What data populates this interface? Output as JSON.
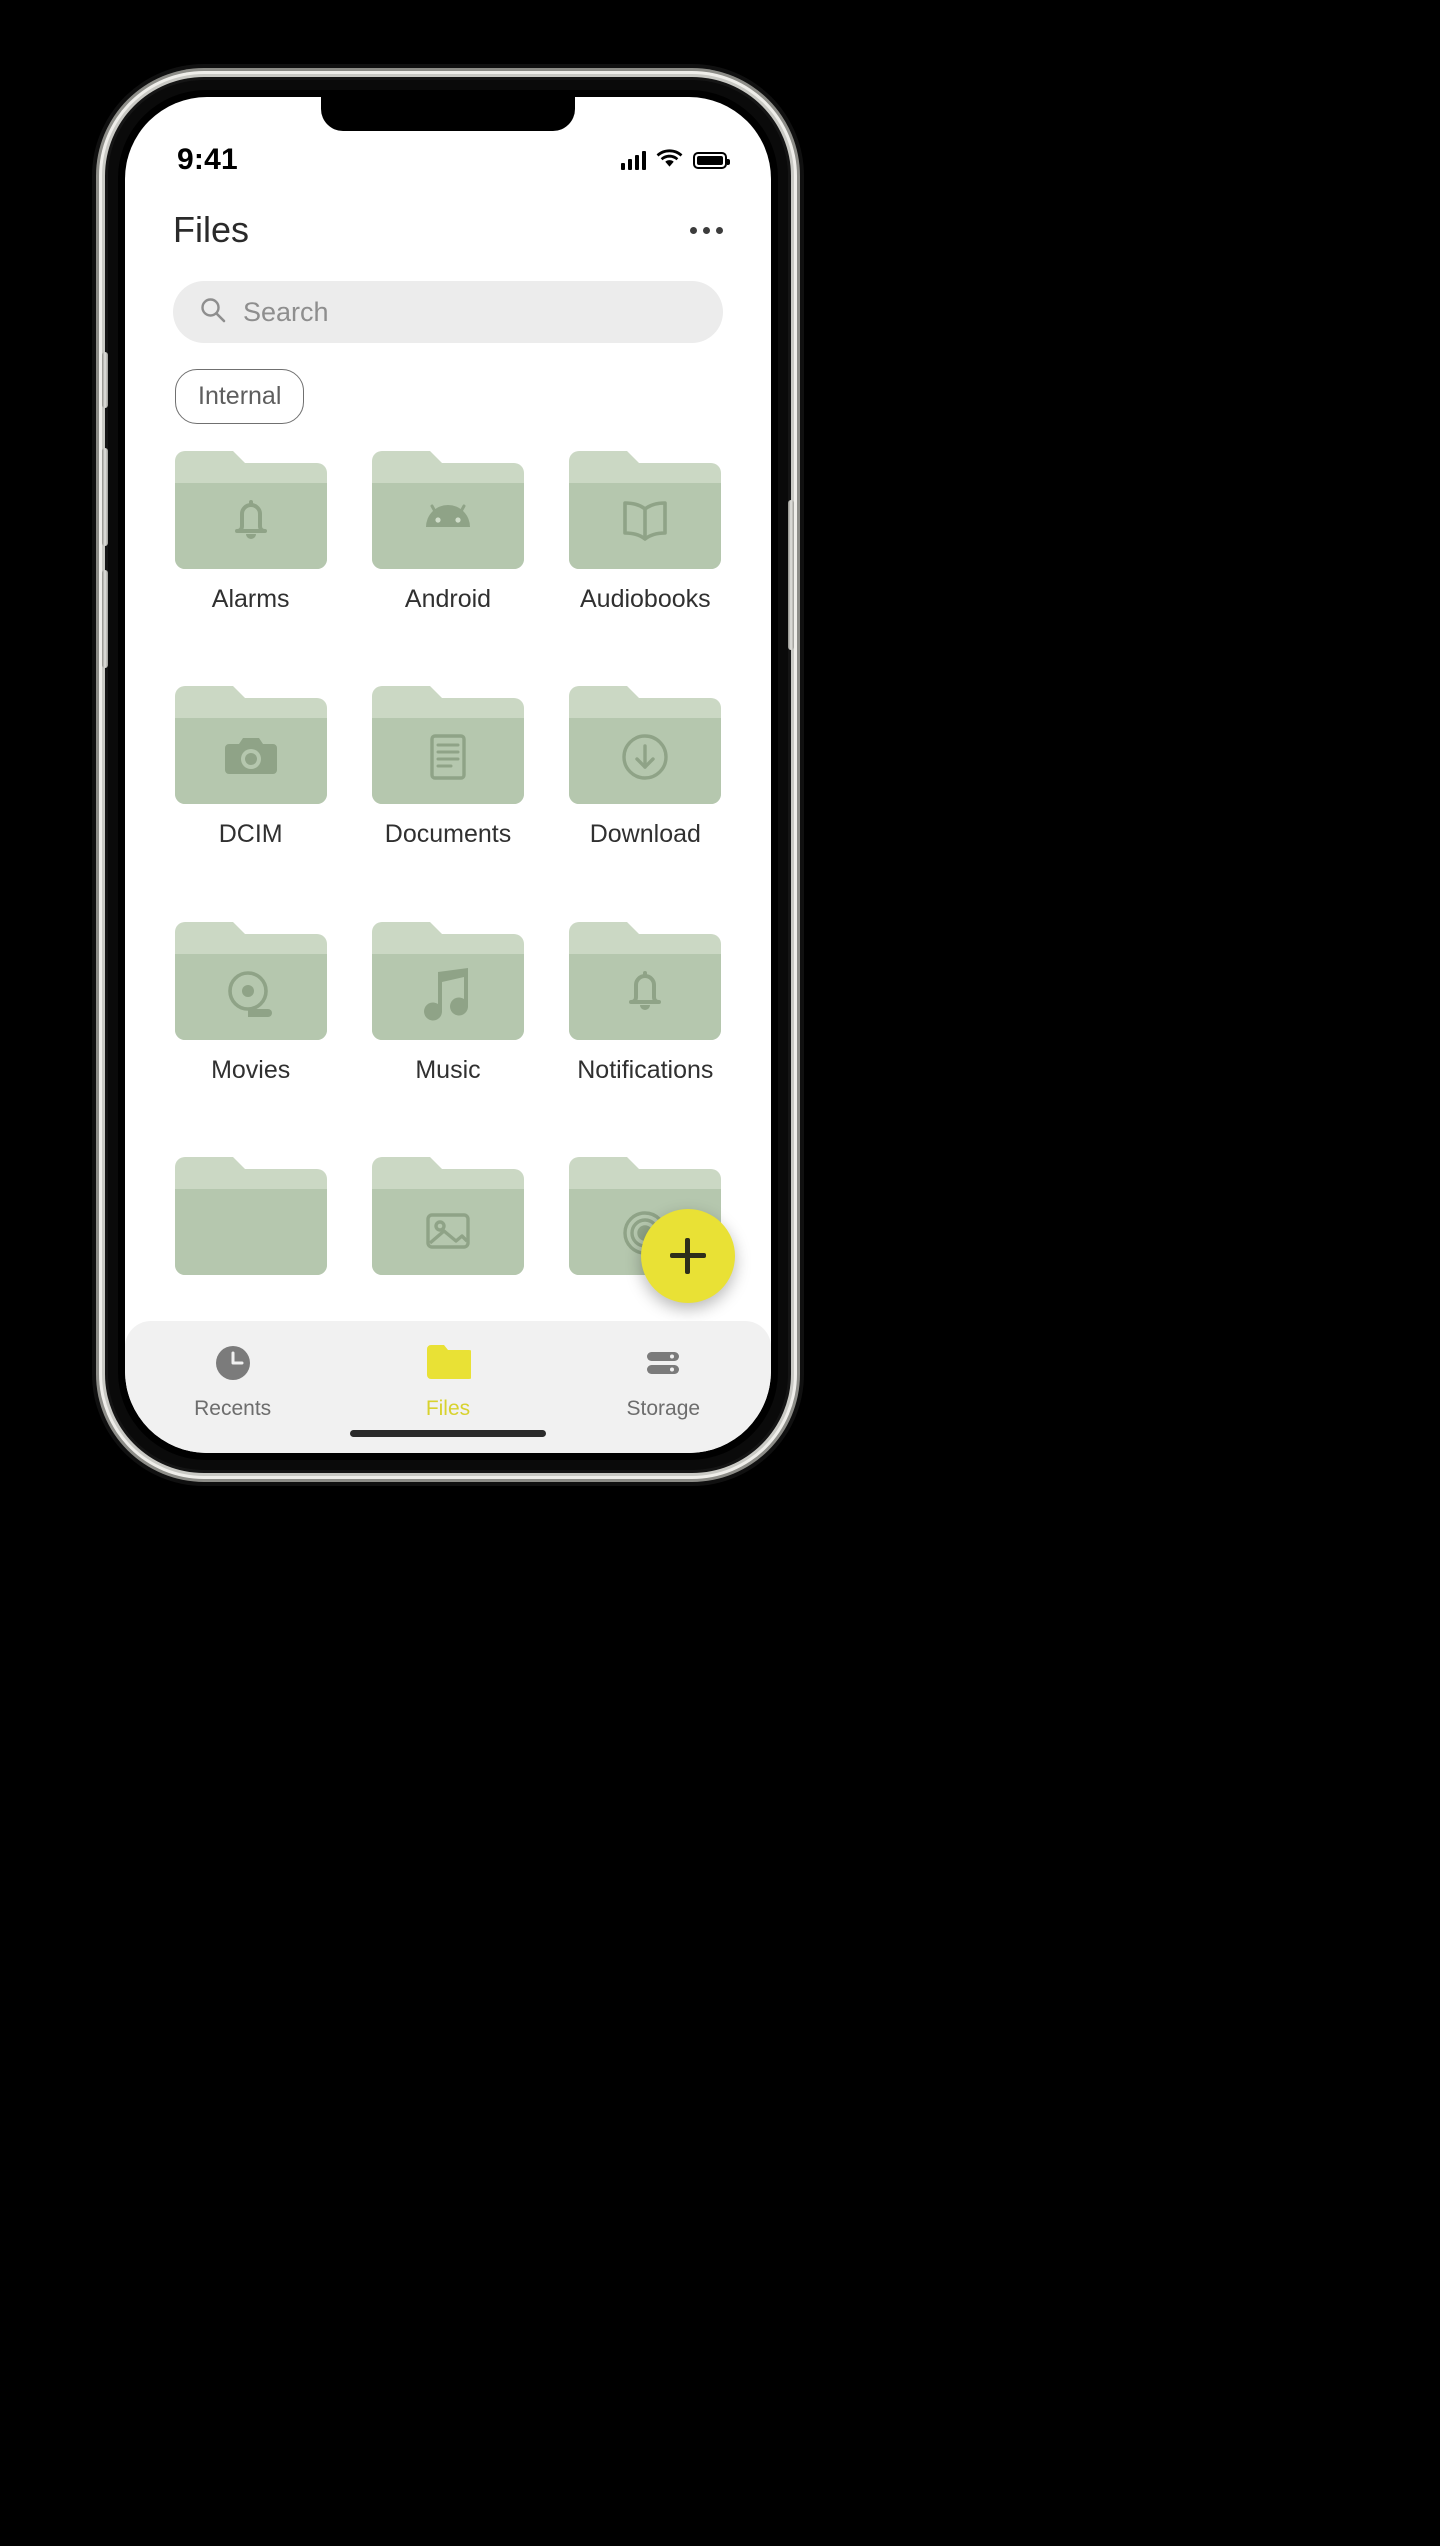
{
  "statusbar": {
    "time": "9:41",
    "signal_icon": "cellular-signal-icon",
    "wifi_icon": "wifi-icon",
    "battery_icon": "battery-full-icon"
  },
  "header": {
    "title": "Files",
    "overflow_label": "•••",
    "overflow_icon": "more-options-icon"
  },
  "search": {
    "placeholder": "Search",
    "icon": "search-icon"
  },
  "chips": [
    {
      "label": "Internal",
      "selected": false
    }
  ],
  "grid": {
    "items": [
      {
        "label": "Alarms",
        "icon": "bell-icon"
      },
      {
        "label": "Android",
        "icon": "android-robot-icon"
      },
      {
        "label": "Audiobooks",
        "icon": "open-book-icon"
      },
      {
        "label": "DCIM",
        "icon": "camera-icon"
      },
      {
        "label": "Documents",
        "icon": "document-lines-icon"
      },
      {
        "label": "Download",
        "icon": "download-arrow-circle-icon"
      },
      {
        "label": "Movies",
        "icon": "film-reel-icon"
      },
      {
        "label": "Music",
        "icon": "music-note-icon"
      },
      {
        "label": "Notifications",
        "icon": "bell-icon"
      },
      {
        "label": "",
        "icon": "blank-icon"
      },
      {
        "label": "",
        "icon": "picture-frame-icon"
      },
      {
        "label": "",
        "icon": "ringtone-waves-icon"
      }
    ]
  },
  "fab": {
    "label": "+",
    "icon": "plus-icon"
  },
  "bottom_nav": {
    "items": [
      {
        "label": "Recents",
        "icon": "clock-icon",
        "active": false
      },
      {
        "label": "Files",
        "icon": "folder-icon",
        "active": true
      },
      {
        "label": "Storage",
        "icon": "storage-bars-icon",
        "active": false
      }
    ]
  },
  "colors": {
    "folder_body": "#b5c7ae",
    "folder_tab": "#cbd8c4",
    "folder_glyph": "#8fa387",
    "accent_yellow": "#e9e135",
    "nav_bg": "#f1f1f1",
    "search_bg": "#ececec"
  }
}
